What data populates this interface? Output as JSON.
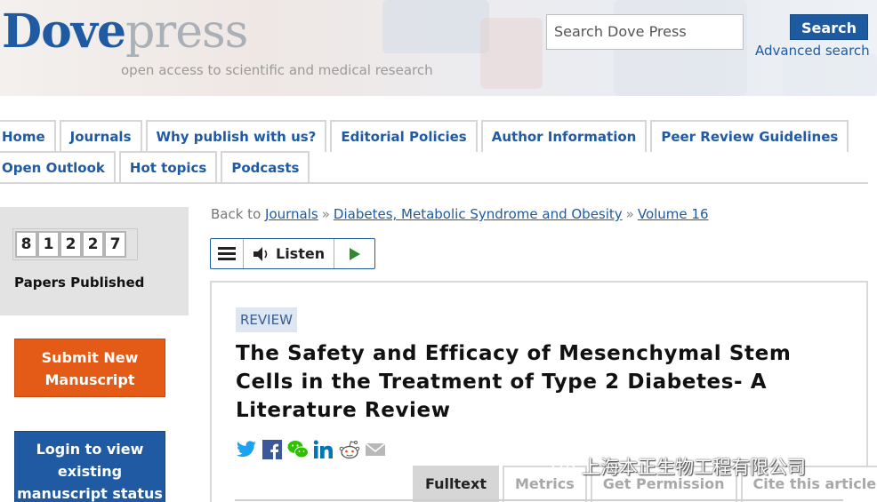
{
  "header": {
    "logo_main": "Dove",
    "logo_sub": "press",
    "tagline": "open access to scientific and medical research",
    "search_placeholder": "Search Dove Press",
    "search_button": "Search",
    "advanced_search": "Advanced search"
  },
  "nav": {
    "row1": [
      "Home",
      "Journals",
      "Why publish with us?",
      "Editorial Policies",
      "Author Information",
      "Peer Review Guidelines"
    ],
    "row2": [
      "Open Outlook",
      "Hot topics",
      "Podcasts"
    ]
  },
  "sidebar": {
    "counter_digits": [
      "8",
      "1",
      "2",
      "2",
      "7"
    ],
    "papers_label": "Papers Published",
    "submit_label": "Submit New Manuscript",
    "login_label": "Login to view existing manuscript status"
  },
  "breadcrumb": {
    "prefix": "Back to",
    "items": [
      "Journals",
      "Diabetes, Metabolic Syndrome and Obesity",
      "Volume 16"
    ],
    "separator": "»"
  },
  "listen_bar": {
    "listen_label": "Listen"
  },
  "article": {
    "tag": "REVIEW",
    "title": "The Safety and Efficacy of Mesenchymal Stem Cells in the Treatment of Type 2 Diabetes- A Literature Review"
  },
  "share_icons": [
    "twitter-icon",
    "facebook-icon",
    "wechat-icon",
    "linkedin-icon",
    "reddit-icon",
    "email-icon"
  ],
  "tabs": [
    "Fulltext",
    "Metrics",
    "Get Permission",
    "Cite this article"
  ],
  "watermark": {
    "text": "上海本正生物工程有限公司"
  },
  "colors": {
    "brand_blue": "#1f5aa3",
    "submit_orange": "#e45a17",
    "review_tag_bg": "#dde6f1"
  }
}
